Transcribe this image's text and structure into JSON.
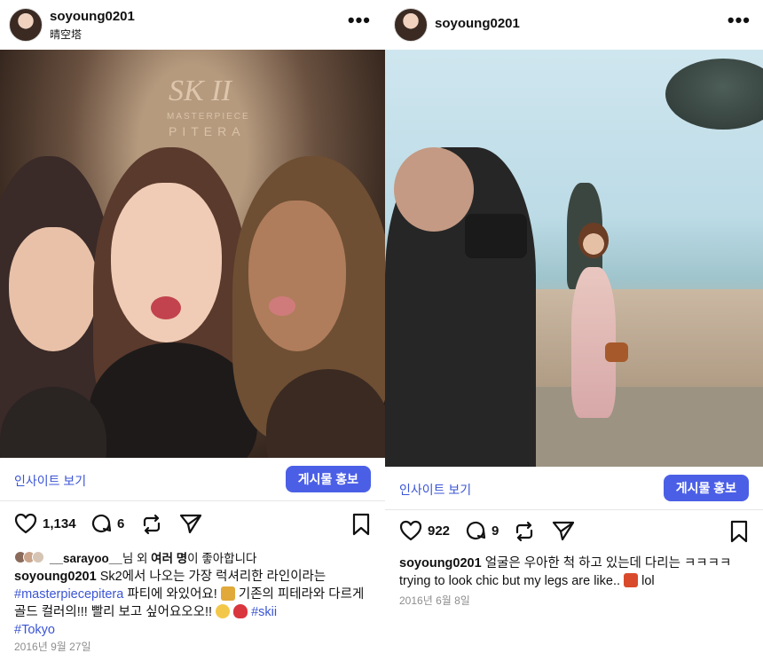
{
  "posts": [
    {
      "username": "soyoung0201",
      "location": "晴空塔",
      "insights_label": "인사이트 보기",
      "promote_label": "게시물 홍보",
      "likes": "1,134",
      "comments": "6",
      "liked_by": {
        "name": "__sarayoo__",
        "rest_pre": "님 외 ",
        "others": "여러 명",
        "rest_post": "이 좋아합니다"
      },
      "caption": {
        "author": "soyoung0201",
        "text_1": " Sk2에서 나오는 가장 럭셔리한 라인이라는 ",
        "hashtag_1": "#masterpiecepitera",
        "text_2": " 파티에 와있어요! ",
        "text_3": " 기존의 피테라와 다르게 골드 컬러의!!! 빨리 보고 싶어요오오!! ",
        "hashtag_2": "#skii",
        "hashtag_3": "#Tokyo"
      },
      "date": "2016년 9월 27일",
      "photo_sign": [
        "SK II",
        "MASTERPIECE",
        "PITERA"
      ]
    },
    {
      "username": "soyoung0201",
      "insights_label": "인사이트 보기",
      "promote_label": "게시물 홍보",
      "likes": "922",
      "comments": "9",
      "caption": {
        "author": "soyoung0201",
        "text_1": " 얼굴은 우아한 척 하고 있는데 다리는 ㅋㅋㅋㅋ trying to look chic but my legs are like.. ",
        "text_2": " lol"
      },
      "date": "2016년 6월 8일"
    }
  ],
  "colors": {
    "accent": "#3b55d4",
    "button": "#4b5fe6",
    "muted": "#8e8e8e"
  },
  "icons": [
    "more-icon",
    "heart-icon",
    "comment-icon",
    "repost-icon",
    "share-icon",
    "bookmark-icon"
  ]
}
